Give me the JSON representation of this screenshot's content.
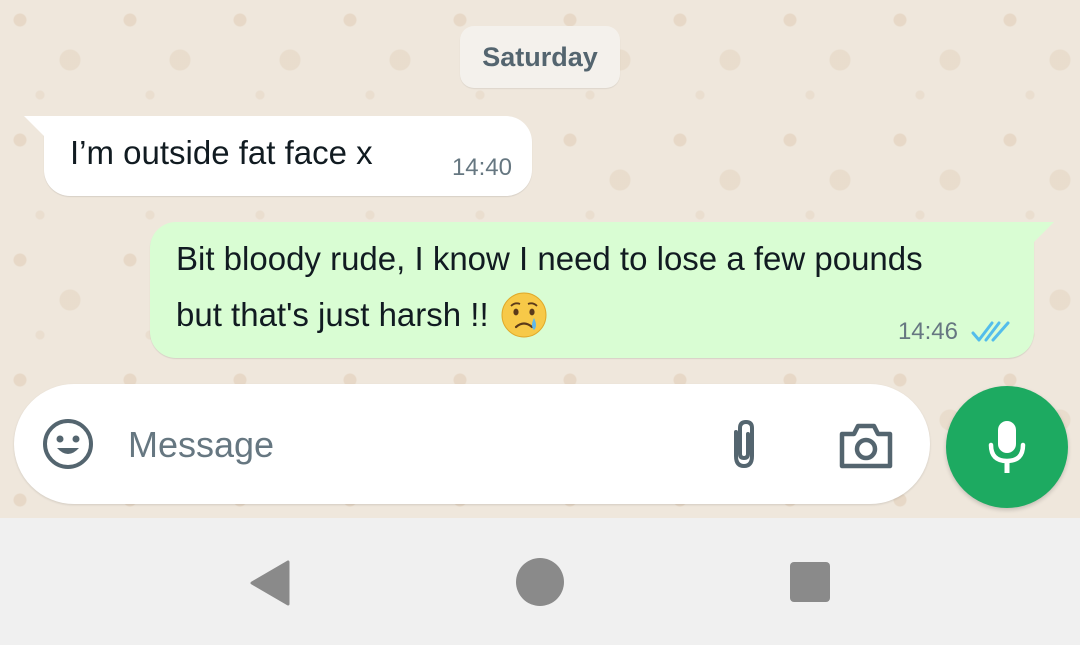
{
  "conversation": {
    "date_separator": "Saturday",
    "messages": [
      {
        "direction": "incoming",
        "text": "I’m outside fat face x",
        "time": "14:40"
      },
      {
        "direction": "outgoing",
        "lines": [
          "Bit bloody rude, I know I need to lose a few pounds",
          "but that's just harsh !!"
        ],
        "emoji": "crying-face",
        "time": "14:46",
        "status": "read"
      }
    ]
  },
  "composer": {
    "placeholder": "Message",
    "icons": [
      "smiley-icon",
      "paperclip-icon",
      "camera-icon",
      "mic-icon"
    ]
  },
  "navigation": {
    "icons": [
      "back-icon",
      "home-icon",
      "recents-icon"
    ]
  },
  "colors": {
    "chat_background": "#efe7dc",
    "incoming_bubble": "#ffffff",
    "outgoing_bubble": "#d9fdd3",
    "accent_green": "#1daa61",
    "read_ticks": "#53bdeb",
    "nav_bar": "#f0f0f0"
  }
}
